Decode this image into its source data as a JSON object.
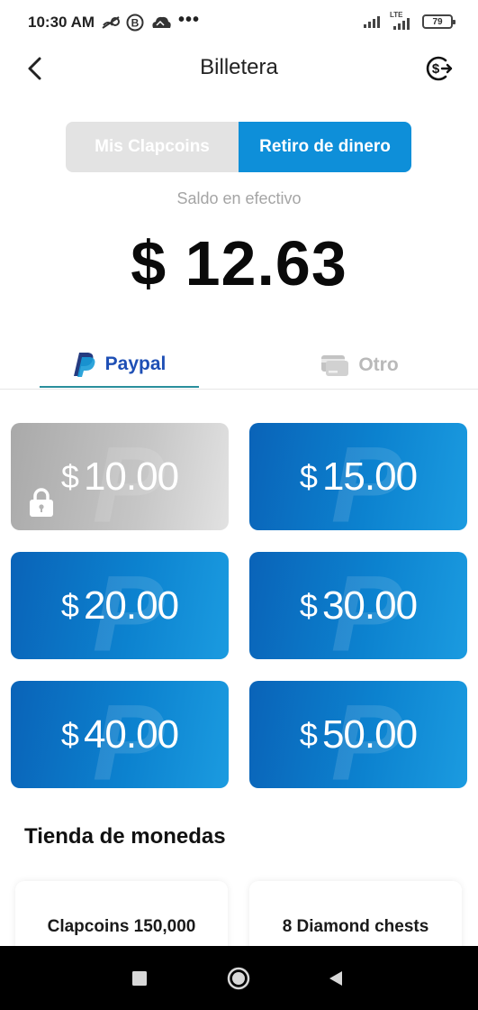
{
  "status_bar": {
    "time": "10:30 AM",
    "overflow": "•••",
    "network": "LTE",
    "battery": "79",
    "icons": [
      "wifi-calling-icon",
      "b-app-icon",
      "cloud-icon",
      "signal-icon",
      "lte-signal-icon",
      "battery-icon"
    ]
  },
  "header": {
    "title": "Billetera",
    "back_icon": "chevron-left-icon",
    "action_icon": "currency-exchange-icon"
  },
  "segment": {
    "tabs": [
      {
        "label": "Mis Clapcoins",
        "active": false
      },
      {
        "label": "Retiro de dinero",
        "active": true
      }
    ]
  },
  "balance": {
    "label": "Saldo en efectivo",
    "amount": "$ 12.63"
  },
  "methods": {
    "paypal_label": "Paypal",
    "other_label": "Otro"
  },
  "amounts": [
    {
      "currency": "$",
      "value": "10.00",
      "locked": true
    },
    {
      "currency": "$",
      "value": "15.00",
      "locked": false
    },
    {
      "currency": "$",
      "value": "20.00",
      "locked": false
    },
    {
      "currency": "$",
      "value": "30.00",
      "locked": false
    },
    {
      "currency": "$",
      "value": "40.00",
      "locked": false
    },
    {
      "currency": "$",
      "value": "50.00",
      "locked": false
    }
  ],
  "store": {
    "title": "Tienda de monedas",
    "items": [
      {
        "label": "Clapcoins 150,000"
      },
      {
        "label": "8 Diamond chests"
      }
    ]
  },
  "colors": {
    "accent": "#0e8fd9",
    "paypal_blue": "#1e4fb5",
    "tab_underline": "#2a8f9c"
  }
}
